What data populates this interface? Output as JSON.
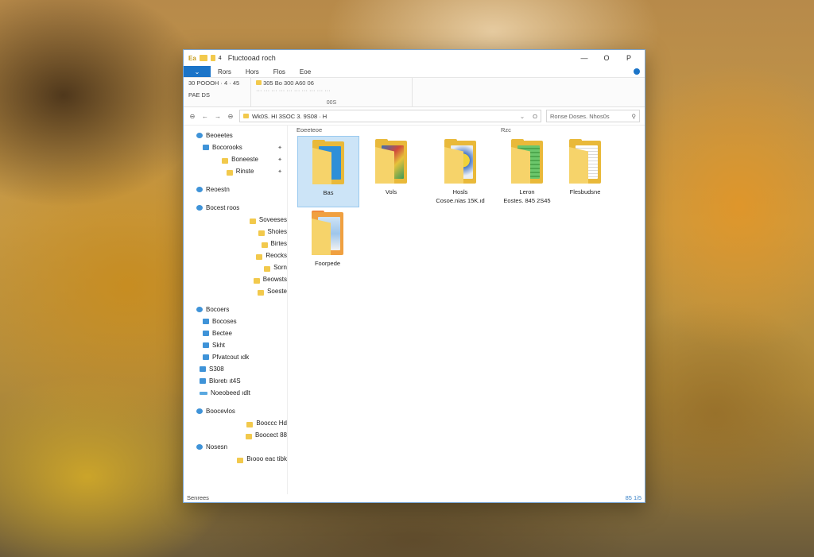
{
  "titlebar": {
    "title": "Ftuctooad roch",
    "qa_left": "Ea",
    "qa_mark": "4",
    "minimize": "—",
    "maximize": "O",
    "close": "P"
  },
  "ribbon_tabs": {
    "file": "⌄",
    "tabs": [
      "Rors",
      "Hors",
      "Flos",
      "Eoe"
    ]
  },
  "ribbon": {
    "group1": {
      "line1": "30 POOOH · 4 · 45",
      "line2": "PAE DS"
    },
    "group2": {
      "line1": "305    Bo    300    A60    06",
      "line2": "··· ··· ··· ··· ··· ··· ··· ··· ··· ···",
      "label": "00S"
    }
  },
  "address": {
    "back": "⊖",
    "forward": "←",
    "up": "→",
    "recent": "⊖",
    "path": "Wk0S. HI  3SOC  3. 9S08 · H",
    "dropdown": "⌄",
    "refresh": "O",
    "search_placeholder": "Ronse Doses. Nhos0s",
    "search_icon": "⚲"
  },
  "sidebar": {
    "quick_access": "Beoeetes",
    "pinned": [
      {
        "label": "Bocorooks",
        "pin": "✦"
      },
      {
        "label": "Boneeste",
        "pin": "✦"
      },
      {
        "label": "Rinste",
        "pin": "✦"
      }
    ],
    "onedrive": "Reoestn",
    "this_pc": "Bocest roos",
    "pc_items": [
      "Soveeses",
      "Shoies",
      "Birtes",
      "Reocks"
    ],
    "sub_parent": "Sorn",
    "sub_items": [
      "Beowsts",
      "Soeste"
    ],
    "network": "Bocoers",
    "network_items": [
      "Bocoses",
      "Bectee",
      "Skht",
      "Pfvatcout ıdk"
    ],
    "drive_items": [
      "S308",
      "Bloretı ıt4S",
      "Noeobeed ıdlt"
    ],
    "group4": "Boocevlos",
    "group4_items": [
      "Booccc Hd",
      "Boocect 88"
    ],
    "group5": "Nosesn",
    "group5_items": [
      "Bıooo eac tibk"
    ]
  },
  "content": {
    "group_a": "Eoeeteoe",
    "group_b": "Rzc",
    "items": [
      {
        "label": "Bas",
        "label2": ""
      },
      {
        "label": "Vols",
        "label2": ""
      },
      {
        "label": "Hosls",
        "label2": "Cosoe.nias  15K.ıd"
      },
      {
        "label": "Leron",
        "label2": "Eostes.  845  2S45"
      },
      {
        "label": "Flesbudsne",
        "label2": ""
      },
      {
        "label": "Foorpede",
        "label2": ""
      }
    ]
  },
  "statusbar": {
    "text": "Senrees",
    "view": "85 1i5"
  }
}
